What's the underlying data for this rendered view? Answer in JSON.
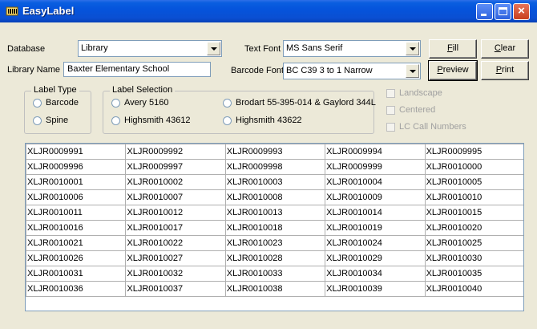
{
  "window": {
    "title": "EasyLabel"
  },
  "database": {
    "label": "Database",
    "value": "Library"
  },
  "library_name": {
    "label": "Library Name",
    "value": "Baxter Elementary School"
  },
  "text_font": {
    "label": "Text Font",
    "value": "MS Sans Serif"
  },
  "barcode_font": {
    "label": "Barcode Font",
    "value": "BC C39 3 to 1 Narrow"
  },
  "buttons": {
    "fill": {
      "accel": "F",
      "rest": "ill"
    },
    "clear": {
      "accel": "C",
      "rest": "lear"
    },
    "preview": {
      "accel": "P",
      "rest": "review"
    },
    "print": {
      "accel": "P",
      "rest": "rint"
    }
  },
  "label_type": {
    "title": "Label Type",
    "options": [
      "Barcode",
      "Spine"
    ]
  },
  "label_selection": {
    "title": "Label Selection",
    "options": [
      "Avery 5160",
      "Highsmith 43612",
      "Brodart 55-395-014 & Gaylord 344L",
      "Highsmith 43622"
    ]
  },
  "options": {
    "landscape": "Landscape",
    "centered": "Centered",
    "lc_call_numbers": "LC Call Numbers"
  },
  "grid": {
    "rows": [
      [
        "XLJR0009991",
        "XLJR0009992",
        "XLJR0009993",
        "XLJR0009994",
        "XLJR0009995"
      ],
      [
        "XLJR0009996",
        "XLJR0009997",
        "XLJR0009998",
        "XLJR0009999",
        "XLJR0010000"
      ],
      [
        "XLJR0010001",
        "XLJR0010002",
        "XLJR0010003",
        "XLJR0010004",
        "XLJR0010005"
      ],
      [
        "XLJR0010006",
        "XLJR0010007",
        "XLJR0010008",
        "XLJR0010009",
        "XLJR0010010"
      ],
      [
        "XLJR0010011",
        "XLJR0010012",
        "XLJR0010013",
        "XLJR0010014",
        "XLJR0010015"
      ],
      [
        "XLJR0010016",
        "XLJR0010017",
        "XLJR0010018",
        "XLJR0010019",
        "XLJR0010020"
      ],
      [
        "XLJR0010021",
        "XLJR0010022",
        "XLJR0010023",
        "XLJR0010024",
        "XLJR0010025"
      ],
      [
        "XLJR0010026",
        "XLJR0010027",
        "XLJR0010028",
        "XLJR0010029",
        "XLJR0010030"
      ],
      [
        "XLJR0010031",
        "XLJR0010032",
        "XLJR0010033",
        "XLJR0010034",
        "XLJR0010035"
      ],
      [
        "XLJR0010036",
        "XLJR0010037",
        "XLJR0010038",
        "XLJR0010039",
        "XLJR0010040"
      ]
    ]
  },
  "colors": {
    "titlebar": "#0a54dc",
    "face": "#ece9d8",
    "field_border": "#7f9db9"
  },
  "icons": [
    "app-icon",
    "minimize-icon",
    "maximize-icon",
    "close-icon",
    "dropdown-arrow-icon"
  ]
}
